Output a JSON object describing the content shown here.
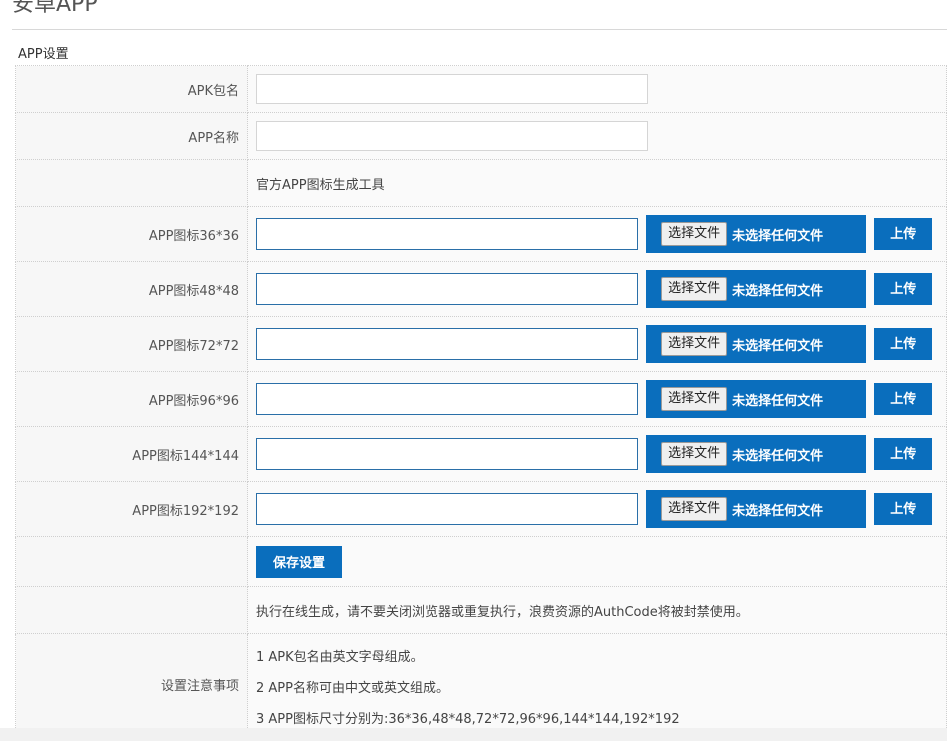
{
  "page": {
    "title": "安卓APP",
    "section": "APP设置"
  },
  "form": {
    "apk_package": {
      "label": "APK包名",
      "value": ""
    },
    "app_name": {
      "label": "APP名称",
      "value": ""
    },
    "icon_tool_link": "官方APP图标生成工具",
    "choose_file_label": "选择文件",
    "no_file_label": "未选择任何文件",
    "upload_label": "上传",
    "icons": [
      {
        "label": "APP图标36*36",
        "value": ""
      },
      {
        "label": "APP图标48*48",
        "value": ""
      },
      {
        "label": "APP图标72*72",
        "value": ""
      },
      {
        "label": "APP图标96*96",
        "value": ""
      },
      {
        "label": "APP图标144*144",
        "value": ""
      },
      {
        "label": "APP图标192*192",
        "value": ""
      }
    ],
    "save_label": "保存设置",
    "execute_notice": "执行在线生成，请不要关闭浏览器或重复执行，浪费资源的AuthCode将被封禁使用。",
    "notes": {
      "label": "设置注意事项",
      "lines": [
        "1 APK包名由英文字母组成。",
        "2 APP名称可由中文或英文组成。",
        "3 APP图标尺寸分别为:36*36,48*48,72*72,96*96,144*144,192*192"
      ]
    }
  },
  "colors": {
    "primary": "#0a6ebd",
    "label_bg": "#f7f7f7",
    "value_bg": "#fafafa"
  }
}
